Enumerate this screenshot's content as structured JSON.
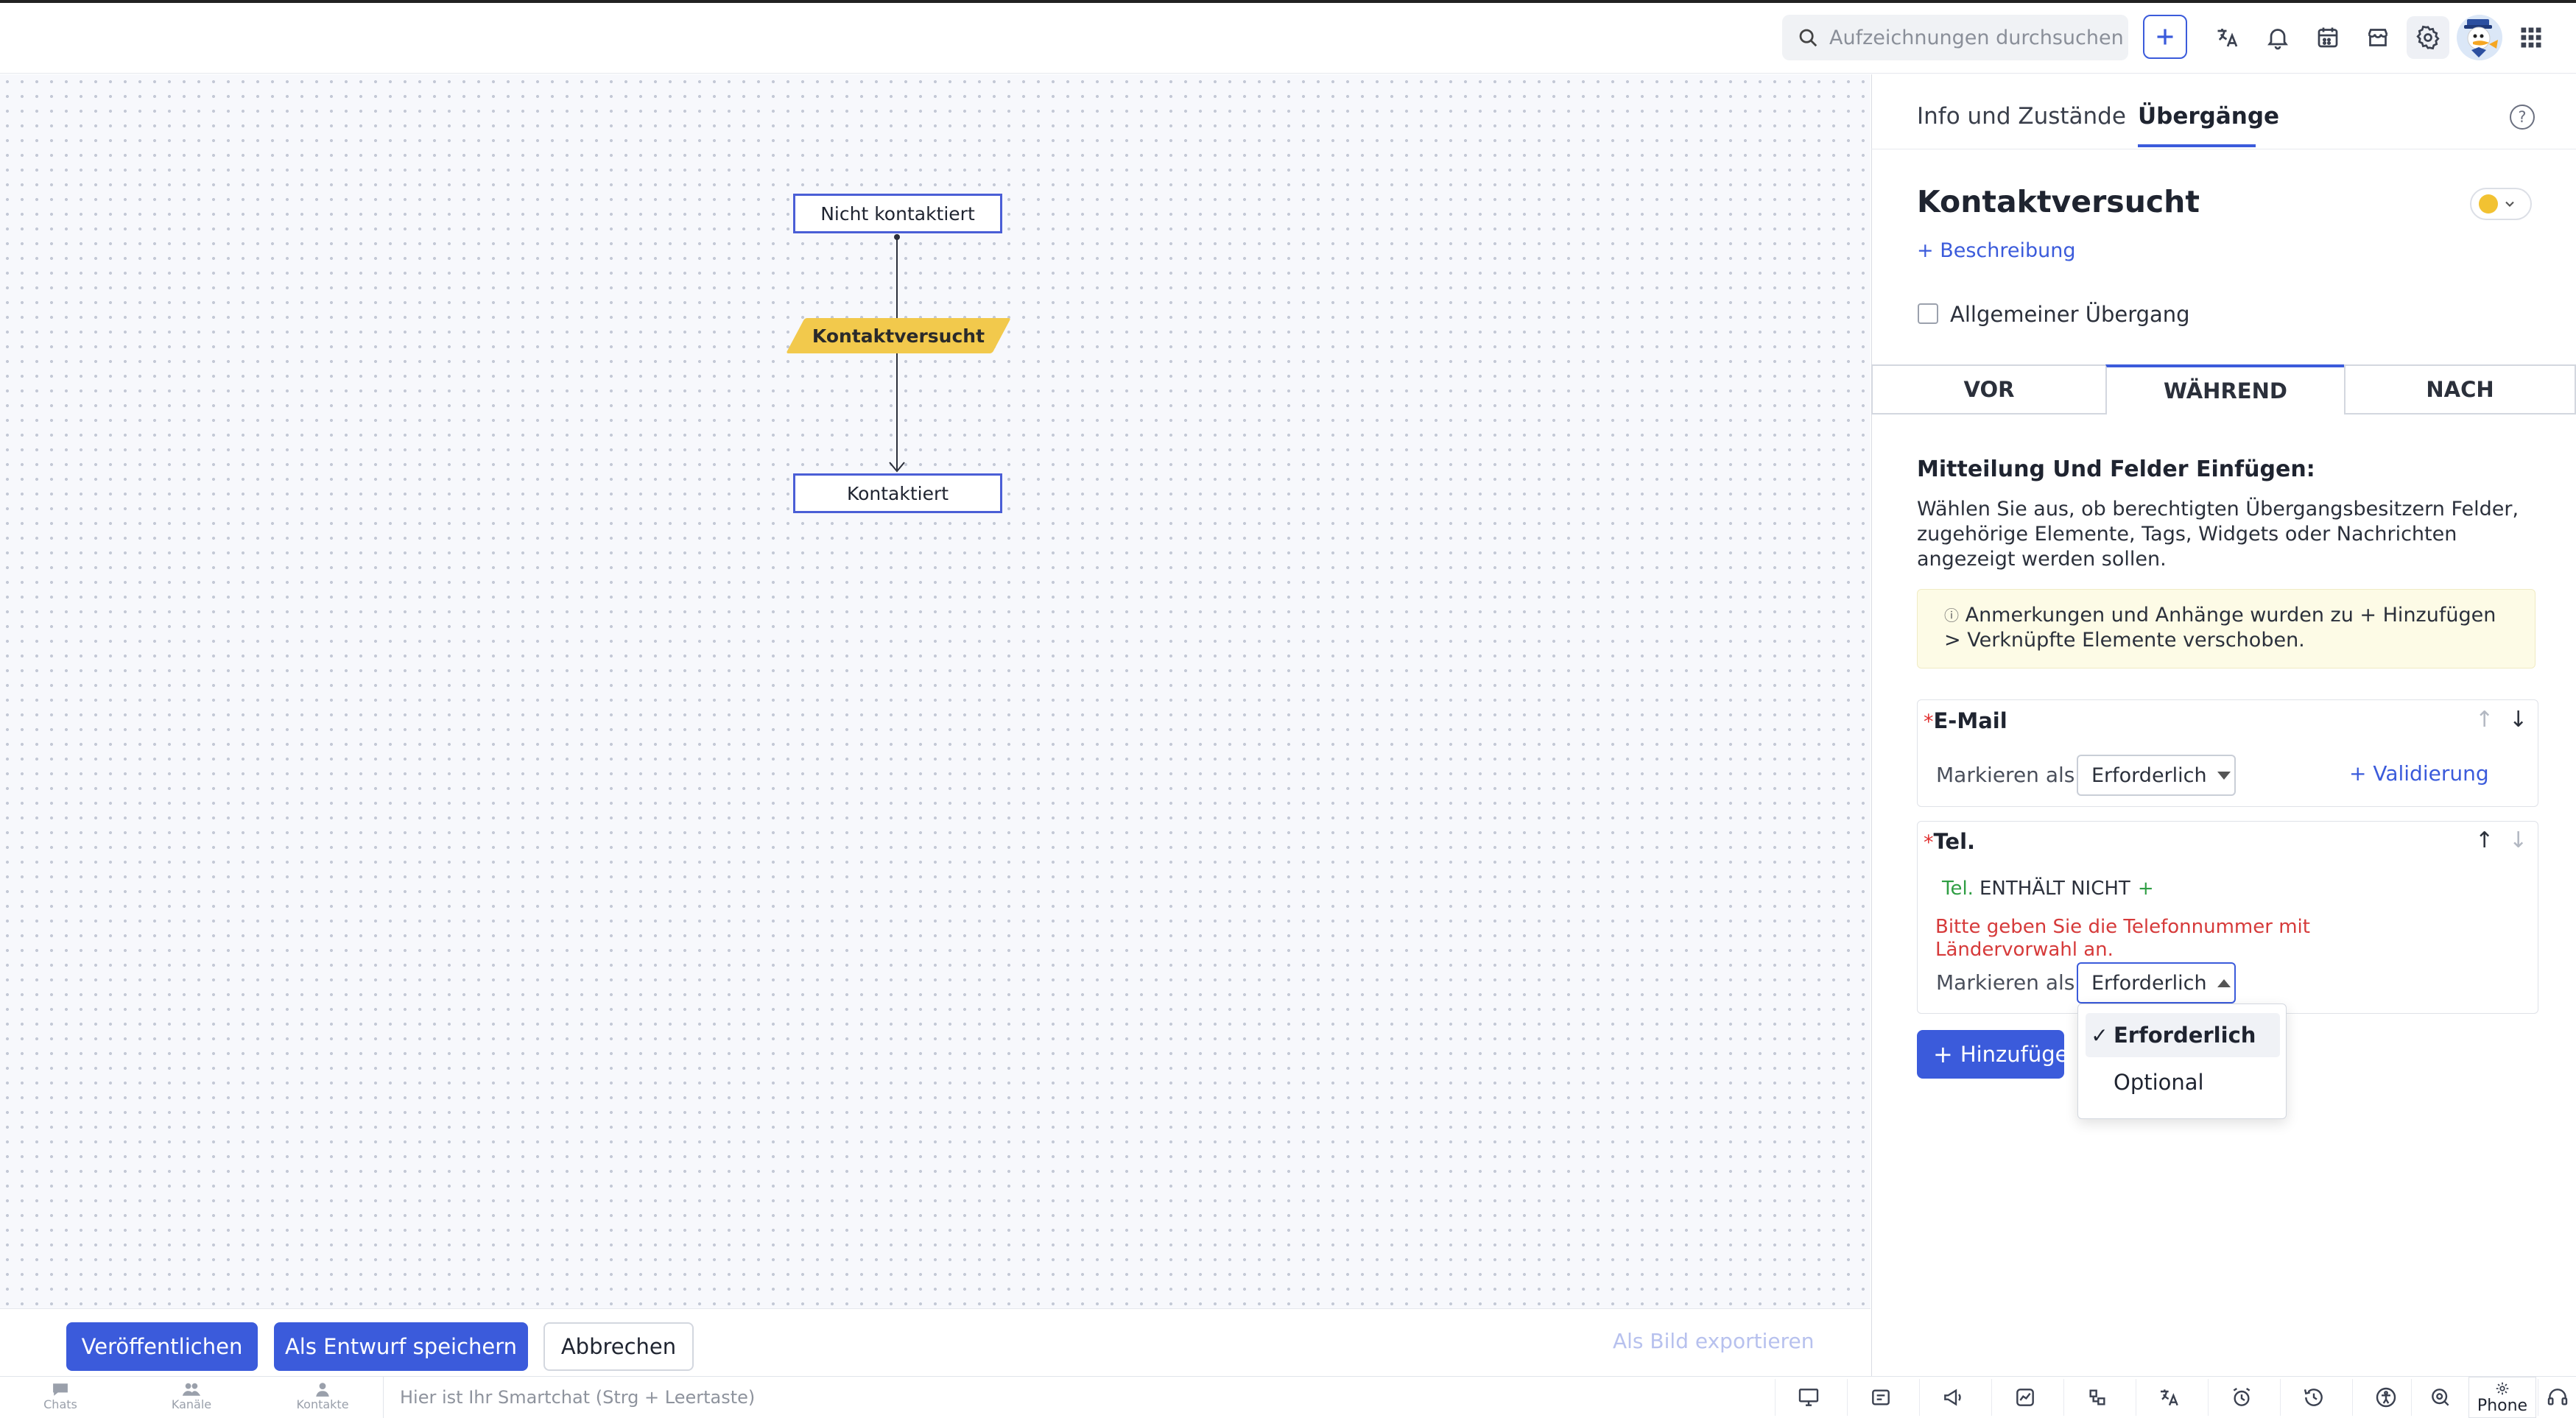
{
  "topbar": {
    "search_placeholder": "Aufzeichnungen durchsuchen"
  },
  "flow": {
    "state_top": "Nicht kontaktiert",
    "transition": "Kontaktversucht",
    "state_bottom": "Kontaktiert"
  },
  "actions": {
    "publish": "Veröffentlichen",
    "save_draft": "Als Entwurf speichern",
    "cancel": "Abbrechen",
    "export_image": "Als Bild exportieren"
  },
  "panel": {
    "tabs": [
      "Info und Zustände",
      "Übergänge"
    ],
    "active_tab": "Übergänge",
    "title": "Kontaktversucht",
    "color": "#f2c232",
    "add_description": "+ Beschreibung",
    "general_transition": "Allgemeiner Übergang",
    "segments": [
      "VOR",
      "WÄHREND",
      "NACH"
    ],
    "active_segment": "WÄHREND",
    "section_title": "Mitteilung Und Felder Einfügen:",
    "section_desc": "Wählen Sie aus, ob berechtigten Übergangsbesitzern Felder, zugehörige Elemente, Tags, Widgets oder Nachrichten angezeigt werden sollen.",
    "info_icon": "ⓘ",
    "info_text": "Anmerkungen und Anhänge wurden zu + Hinzufügen > Verknüpfte Elemente verschoben.",
    "fields": [
      {
        "required_mark": "*",
        "name": "E-Mail",
        "mark_label": "Markieren als",
        "value": "Erforderlich",
        "validation": "+ Validierung"
      },
      {
        "required_mark": "*",
        "name": "Tel.",
        "condition_field": "Tel.",
        "condition_op": "ENTHÄLT NICHT",
        "condition_plus": "+",
        "error": "Bitte geben Sie die Telefonnummer mit Ländervorwahl an.",
        "mark_label": "Markieren als",
        "value": "Erforderlich"
      }
    ],
    "add_button": "Hinzufügen",
    "dropdown": {
      "options": [
        "Erforderlich",
        "Optional"
      ],
      "selected": "Erforderlich",
      "check": "✓"
    }
  },
  "statusbar": {
    "chats": "Chats",
    "channels": "Kanäle",
    "contacts": "Kontakte",
    "smartchat_placeholder": "Hier ist Ihr Smartchat (Strg + Leertaste)",
    "phone": "Phone"
  },
  "colors": {
    "accent": "#3b5bdb",
    "transition_fill": "#f2c94c",
    "error": "#d63a3a",
    "condition": "#2f9e44"
  }
}
